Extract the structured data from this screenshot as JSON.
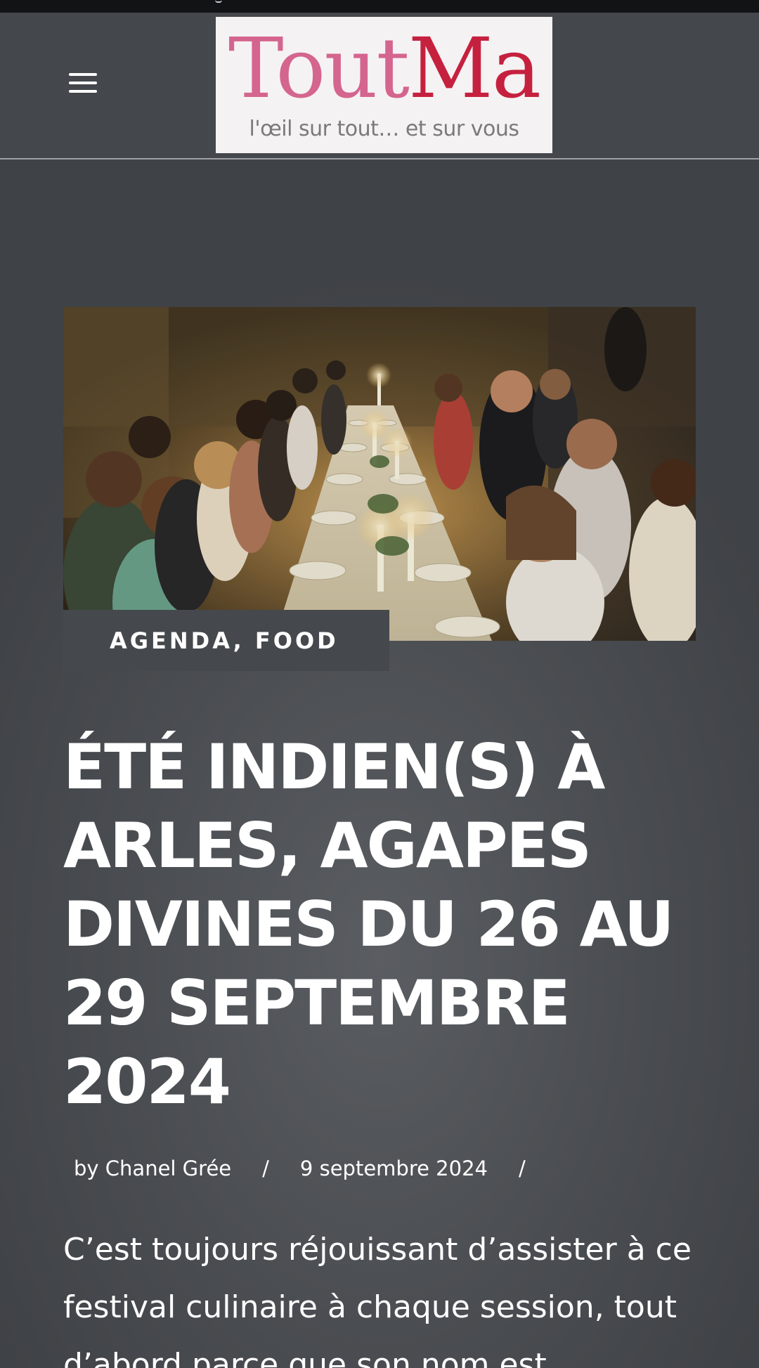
{
  "header": {
    "menu_icon": "hamburger-menu-icon",
    "logo": {
      "word_part1": "Tout",
      "word_part2": "Ma",
      "tagline": "l'œil sur tout…  et sur vous"
    }
  },
  "article": {
    "hero_image_alt": "Long candlelit dinner table with guests in a stone cellar",
    "categories": "AGENDA, FOOD",
    "title": "ÉTÉ INDIEN(S) À ARLES, AGAPES DIVINES DU 26 AU 29 SEPTEMBRE 2024",
    "author": "by Chanel Grée",
    "separator": "/",
    "date": "9 septembre 2024",
    "excerpt": "C’est toujours réjouissant d’assister à ce festival culinaire à chaque session, tout d’abord parce que son nom est"
  },
  "colors": {
    "background": "#4a4d51",
    "logo_pink": "#d4658e",
    "logo_red": "#c5213f"
  }
}
